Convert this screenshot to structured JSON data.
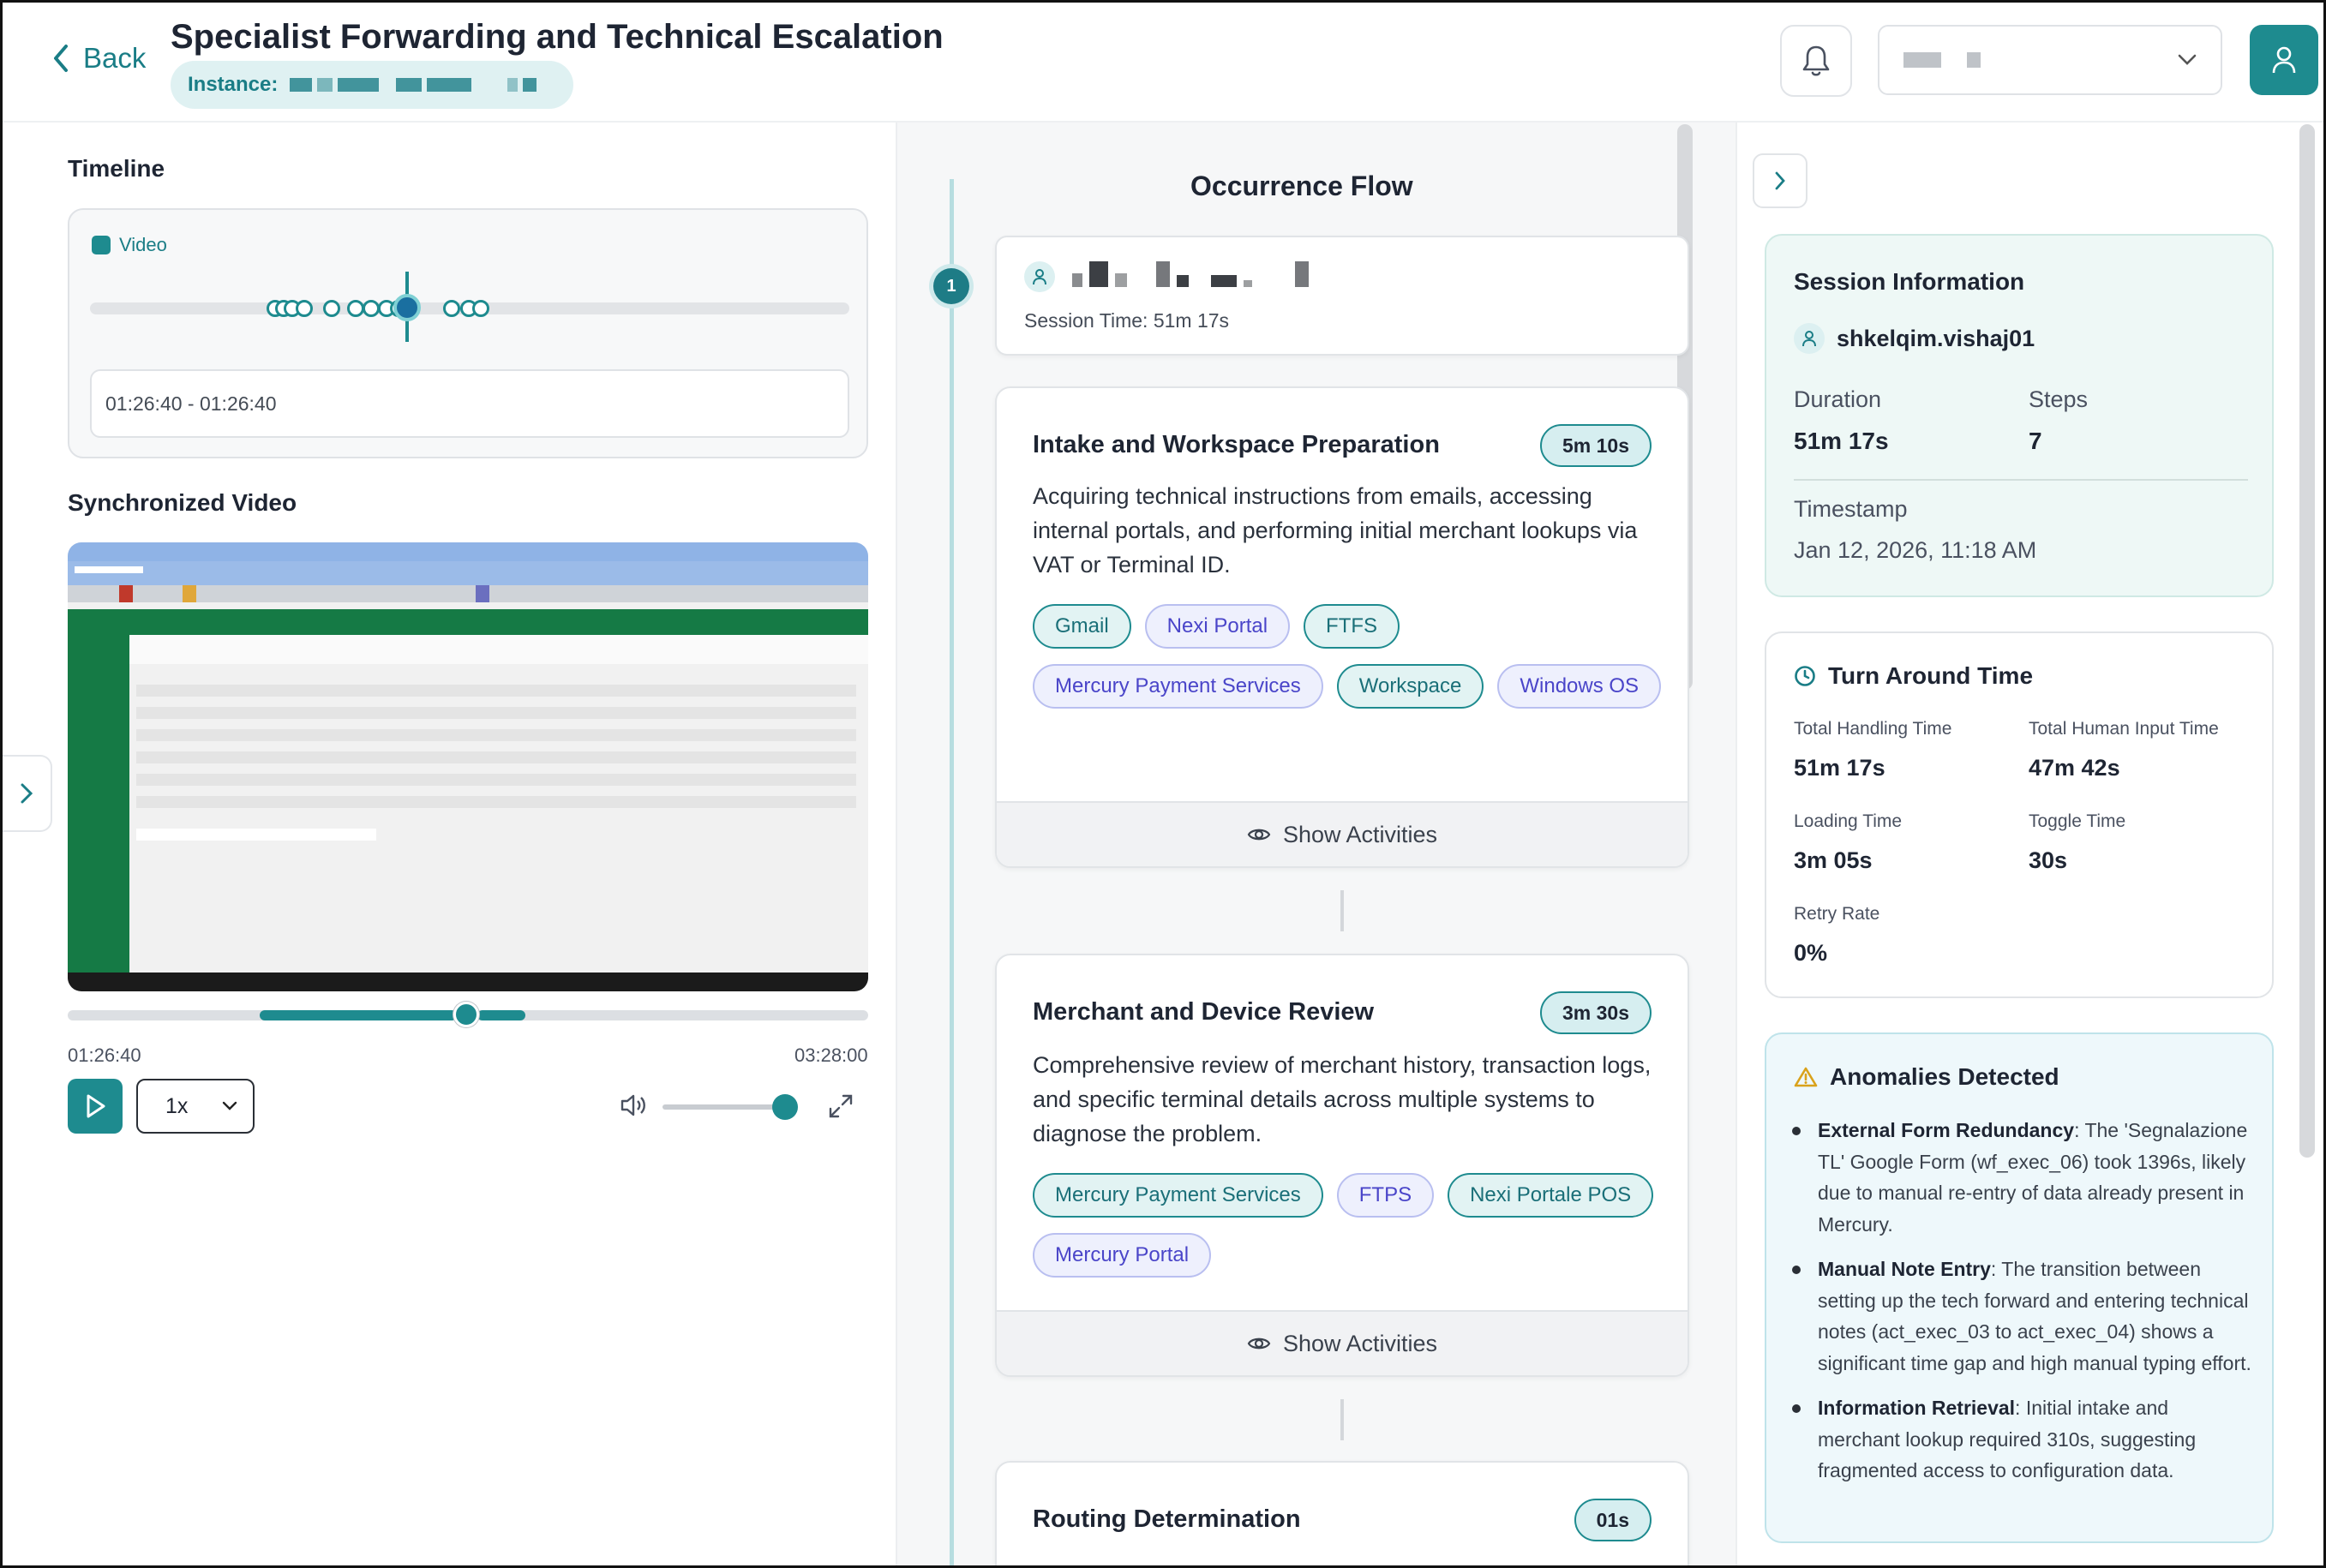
{
  "header": {
    "back_label": "Back",
    "title": "Specialist Forwarding and Technical Escalation",
    "instance_label": "Instance:"
  },
  "timeline": {
    "heading": "Timeline",
    "legend_label": "Video",
    "range": "01:26:40 - 01:26:40"
  },
  "video": {
    "heading": "Synchronized Video",
    "current_time": "01:26:40",
    "duration": "03:28:00",
    "speed": "1x",
    "progress_fraction": 0.42,
    "volume_fraction": 0.95
  },
  "flow": {
    "heading": "Occurrence Flow",
    "step_number": "1",
    "session_time": "Session Time: 51m 17s",
    "show_activities_label": "Show Activities",
    "steps": [
      {
        "title": "Intake and Workspace Preparation",
        "duration": "5m 10s",
        "description": "Acquiring technical instructions from emails, accessing internal portals, and performing initial merchant lookups via VAT or Terminal ID.",
        "tags": [
          {
            "label": "Gmail",
            "style": "teal"
          },
          {
            "label": "Nexi Portal",
            "style": "purple"
          },
          {
            "label": "FTFS",
            "style": "teal"
          },
          {
            "label": "Mercury Payment Services",
            "style": "purple"
          },
          {
            "label": "Workspace",
            "style": "teal"
          },
          {
            "label": "Windows OS",
            "style": "purple"
          }
        ]
      },
      {
        "title": "Merchant and Device Review",
        "duration": "3m 30s",
        "description": "Comprehensive review of merchant history, transaction logs, and specific terminal details across multiple systems to diagnose the problem.",
        "tags": [
          {
            "label": "Mercury Payment Services",
            "style": "teal"
          },
          {
            "label": "FTPS",
            "style": "purple"
          },
          {
            "label": "Nexi Portale POS",
            "style": "teal"
          },
          {
            "label": "Mercury Portal",
            "style": "purple"
          }
        ]
      },
      {
        "title": "Routing Determination",
        "duration": "01s"
      }
    ]
  },
  "session_info": {
    "heading": "Session Information",
    "username": "shkelqim.vishaj01",
    "duration_label": "Duration",
    "duration_value": "51m 17s",
    "steps_label": "Steps",
    "steps_value": "7",
    "timestamp_label": "Timestamp",
    "timestamp_value": "Jan 12, 2026, 11:18 AM"
  },
  "tat": {
    "heading": "Turn Around Time",
    "total_handling_label": "Total Handling Time",
    "total_handling_value": "51m 17s",
    "total_human_label": "Total Human Input Time",
    "total_human_value": "47m 42s",
    "loading_label": "Loading Time",
    "loading_value": "3m 05s",
    "toggle_label": "Toggle Time",
    "toggle_value": "30s",
    "retry_label": "Retry Rate",
    "retry_value": "0%"
  },
  "anomalies": {
    "heading": "Anomalies Detected",
    "items": [
      {
        "title": "External Form Redundancy",
        "text": ": The 'Segnalazione TL' Google Form (wf_exec_06) took 1396s, likely due to manual re-entry of data already present in Mercury."
      },
      {
        "title": "Manual Note Entry",
        "text": ": The transition between setting up the tech forward and entering technical notes (act_exec_03 to act_exec_04) shows a significant time gap and high manual typing effort."
      },
      {
        "title": "Information Retrieval",
        "text": ": Initial intake and merchant lookup required 310s, suggesting fragmented access to configuration data."
      }
    ]
  },
  "colors": {
    "accent": "#1e8b8f",
    "tag_teal": "#e2f3f3",
    "tag_purple": "#eef0fd",
    "anomaly_icon": "#d9a21b"
  }
}
